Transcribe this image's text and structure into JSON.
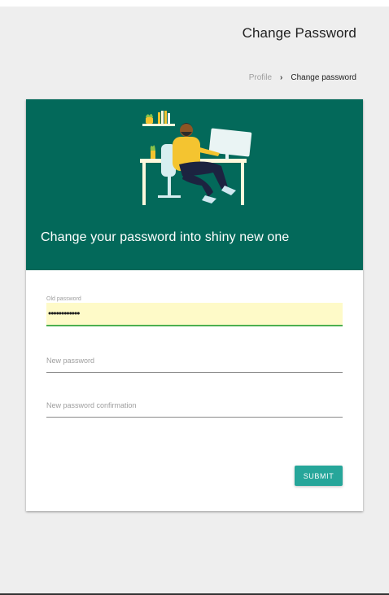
{
  "header": {
    "title": "Change Password"
  },
  "breadcrumb": {
    "items": [
      {
        "label": "Profile"
      },
      {
        "label": "Change password"
      }
    ],
    "separator": "›"
  },
  "hero": {
    "caption": "Change your password into shiny new one",
    "background_color": "#03695a",
    "illustration": "person-at-desk-illustration"
  },
  "form": {
    "old_password": {
      "label": "Old password",
      "value": "••••••••••••"
    },
    "new_password": {
      "placeholder": "New password",
      "value": ""
    },
    "new_password_confirmation": {
      "placeholder": "New password confirmation",
      "value": ""
    },
    "submit_label": "SUBMIT",
    "accent_color": "#26a69a"
  }
}
